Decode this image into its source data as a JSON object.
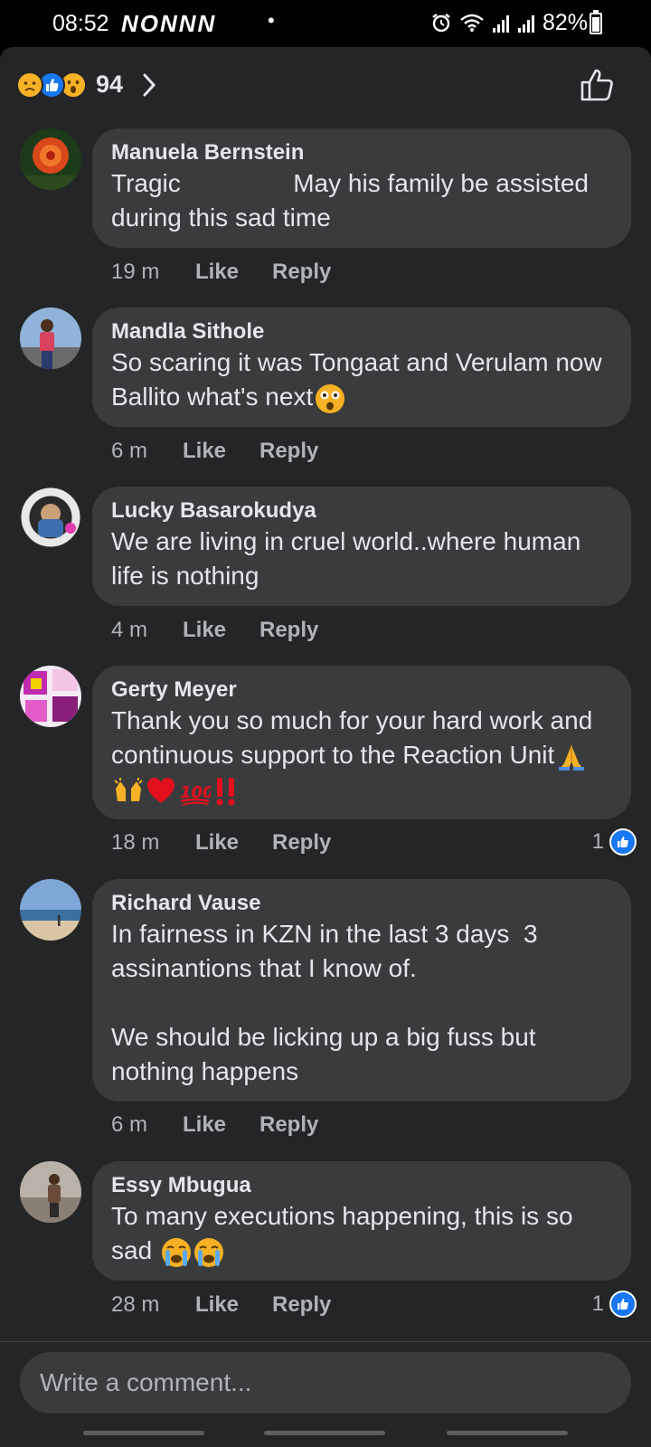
{
  "status_bar": {
    "time": "08:52",
    "notification_icons": "NONNN",
    "dot": "•",
    "battery": "82%"
  },
  "header": {
    "reaction_count": "94",
    "reactions": [
      "sad",
      "like",
      "wow"
    ]
  },
  "comments": [
    {
      "author": "Manuela Bernstein",
      "text": "Tragic                May his family be assisted during this sad time",
      "time": "19 m",
      "like_label": "Like",
      "reply_label": "Reply",
      "likes": ""
    },
    {
      "author": "Mandla Sithole",
      "text": "So scaring it was Tongaat and Verulam now Ballito what's next",
      "time": "6 m",
      "like_label": "Like",
      "reply_label": "Reply",
      "likes": "",
      "emoji": [
        "wow"
      ]
    },
    {
      "author": "Lucky Basarokudya",
      "text": "We are living in cruel world..where human life is nothing",
      "time": "4 m",
      "like_label": "Like",
      "reply_label": "Reply",
      "likes": ""
    },
    {
      "author": "Gerty Meyer",
      "text": "Thank you so much for your hard work and continuous support to the Reaction Unit",
      "time": "18 m",
      "like_label": "Like",
      "reply_label": "Reply",
      "likes": "1",
      "emoji": [
        "folded-hands",
        "raised-hands",
        "red-heart",
        "hundred-points",
        "double-exclamation"
      ]
    },
    {
      "author": "Richard Vause",
      "text": "In fairness in KZN in the last 3 days  3 assinantions that I know of.\n\nWe should be licking up a big fuss but nothing happens",
      "time": "6 m",
      "like_label": "Like",
      "reply_label": "Reply",
      "likes": ""
    },
    {
      "author": "Essy Mbugua",
      "text": "To many executions happening, this is so sad",
      "time": "28 m",
      "like_label": "Like",
      "reply_label": "Reply",
      "likes": "1",
      "emoji": [
        "crying-face",
        "crying-face"
      ]
    }
  ],
  "composer": {
    "placeholder": "Write a comment..."
  },
  "colors": {
    "background": "#242526",
    "bubble": "#3a3b3c",
    "text_primary": "#e4e6eb",
    "text_secondary": "#b0b3b8",
    "like_blue": "#1877f2"
  }
}
